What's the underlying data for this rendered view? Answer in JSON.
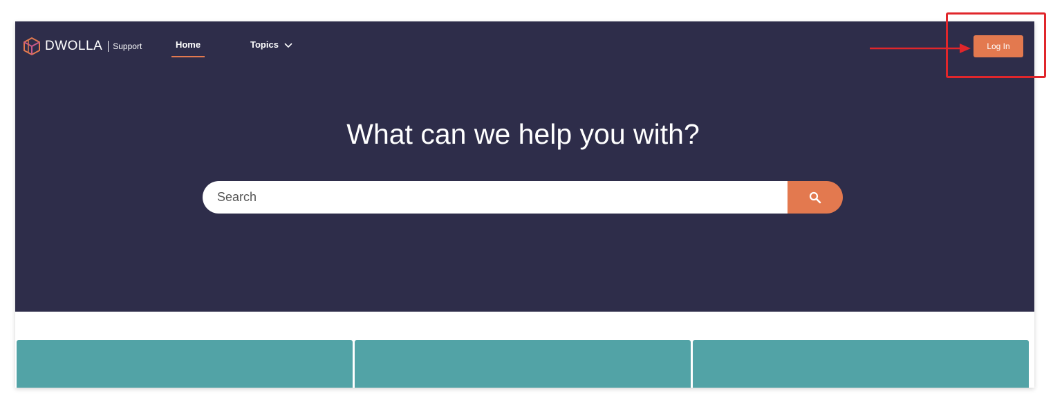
{
  "brand": {
    "name": "DWOLLA",
    "suffix": "Support"
  },
  "nav": {
    "home_label": "Home",
    "topics_label": "Topics"
  },
  "header": {
    "login_label": "Log In"
  },
  "hero": {
    "headline": "What can we help you with?"
  },
  "search": {
    "placeholder": "Search",
    "value": ""
  },
  "cards": [
    {
      "label": ""
    },
    {
      "label": ""
    },
    {
      "label": ""
    }
  ],
  "colors": {
    "hero_background": "#2e2d4a",
    "accent": "#e3794f",
    "card": "#52a3a6",
    "annotation": "#e0262b"
  },
  "icons": {
    "logo": "dwolla-logo-icon",
    "chevron": "chevron-down-icon",
    "search": "search-icon"
  }
}
